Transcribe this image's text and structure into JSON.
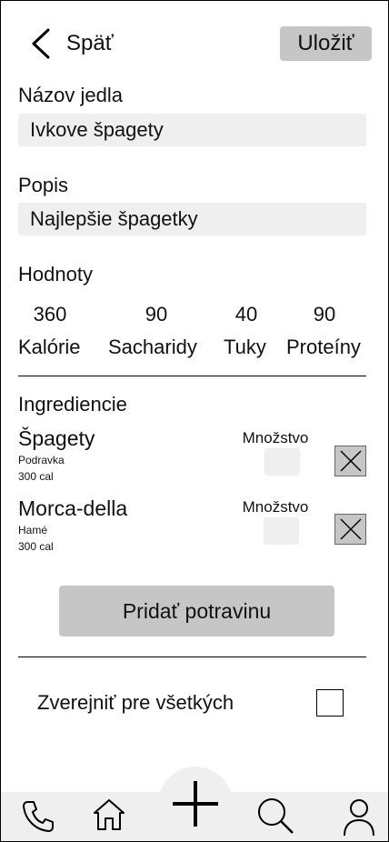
{
  "header": {
    "back_label": "Späť",
    "save_label": "Uložiť"
  },
  "form": {
    "name_label": "Názov jedla",
    "name_value": "Ivkove špagety",
    "desc_label": "Popis",
    "desc_value": "Najlepšie špagetky"
  },
  "values": {
    "label": "Hodnoty",
    "items": [
      {
        "value": "360",
        "name": "Kalórie"
      },
      {
        "value": "90",
        "name": "Sacharidy"
      },
      {
        "value": "40",
        "name": "Tuky"
      },
      {
        "value": "90",
        "name": "Proteíny"
      }
    ]
  },
  "ingredients": {
    "label": "Ingrediencie",
    "quantity_label": "Množstvo",
    "items": [
      {
        "name": "Špagety",
        "brand": "Podravka",
        "calories": "300 cal"
      },
      {
        "name": "Morca-della",
        "brand": "Hamé",
        "calories": "300 cal"
      }
    ]
  },
  "add_food_label": "Pridať potravinu",
  "publish_label": "Zverejniť pre všetkých",
  "nav": {
    "icons": [
      "phone-icon",
      "home-icon",
      "add-icon",
      "search-icon",
      "user-icon"
    ]
  }
}
